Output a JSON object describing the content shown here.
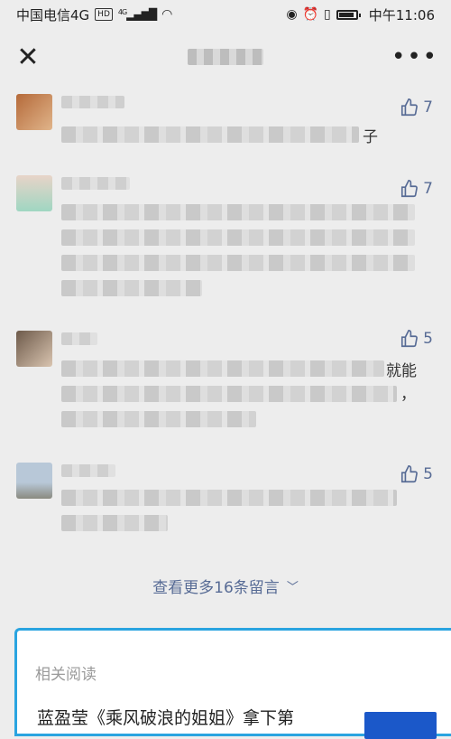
{
  "status_bar": {
    "carrier": "中国电信4G",
    "hd": "HD",
    "signal": "4G",
    "time": "中午11:06"
  },
  "nav": {
    "close_glyph": "✕",
    "more_glyph": "•••"
  },
  "comments": [
    {
      "likes": "7",
      "tail": "子"
    },
    {
      "likes": "7"
    },
    {
      "likes": "5",
      "tail": "就能",
      "tail2": "，"
    },
    {
      "likes": "5"
    }
  ],
  "more_comments": {
    "label": "查看更多16条留言"
  },
  "related": {
    "label": "相关阅读",
    "title": "蓝盈莹《乘风破浪的姐姐》拿下第"
  },
  "colors": {
    "link": "#576b95",
    "background": "#ededed",
    "accent_border": "#2aa4e0"
  }
}
